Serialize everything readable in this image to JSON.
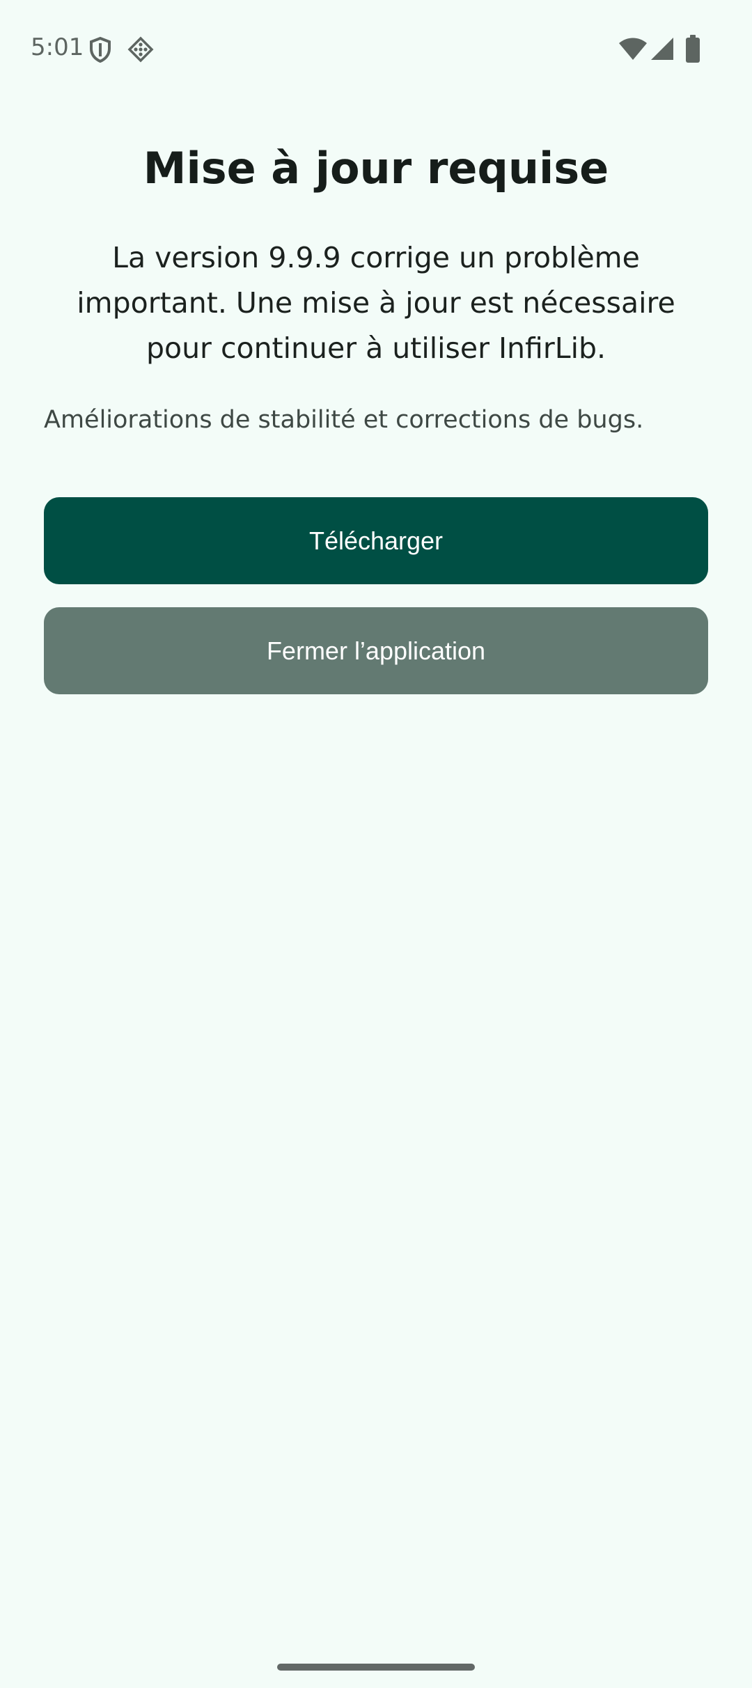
{
  "status_bar": {
    "time": "5:01",
    "left_icons": [
      "shield-icon",
      "sim-toolkit-icon"
    ],
    "right_icons": [
      "wifi-icon",
      "cellular-signal-icon",
      "battery-icon"
    ]
  },
  "screen": {
    "title": "Mise à jour requise",
    "message": "La version 9.9.9 corrige un problème important. Une mise à jour est nécessaire pour continuer à utiliser InfirLib.",
    "release_notes": "Améliorations de stabilité et corrections de bugs."
  },
  "actions": {
    "download_label": "Télécharger",
    "close_app_label": "Fermer l’application"
  },
  "colors": {
    "background": "#f3fcf8",
    "primary_button": "#004f44",
    "secondary_button": "#637a72",
    "title_text": "#161d1a",
    "body_text": "#3e4844"
  }
}
